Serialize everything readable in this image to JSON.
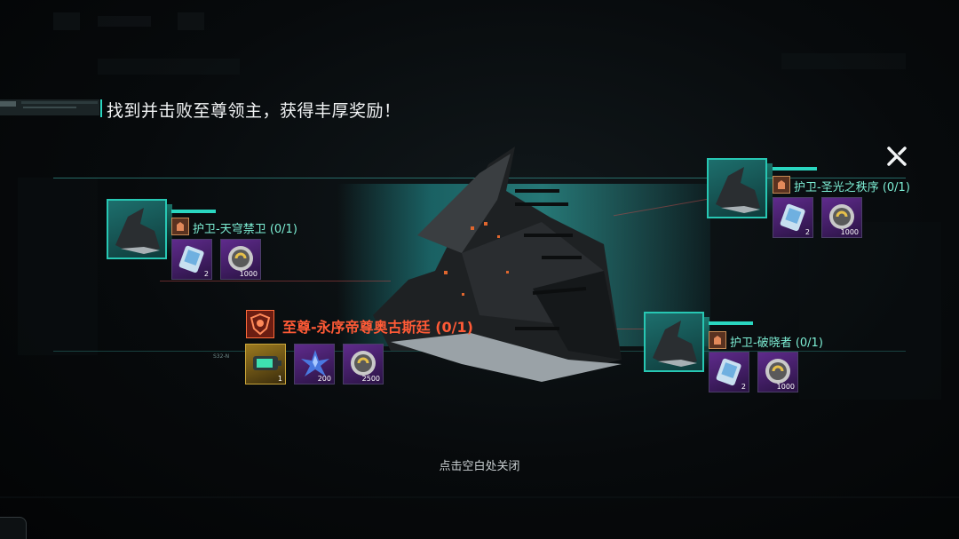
{
  "header": {
    "title": "找到并击败至尊领主，获得丰厚奖励！"
  },
  "close": {
    "icon": "close-icon"
  },
  "boss": {
    "label": "至尊-永序帝尊奥古斯廷 (0/1)",
    "rewards": [
      {
        "icon": "battery-icon",
        "qty": "1",
        "rarity": "gold"
      },
      {
        "icon": "crystal-icon",
        "qty": "200",
        "rarity": "purple"
      },
      {
        "icon": "coin-icon",
        "qty": "2500",
        "rarity": "purple"
      }
    ]
  },
  "guards": [
    {
      "label": "护卫-天穹禁卫 (0/1)",
      "rewards": [
        {
          "icon": "chip-card-icon",
          "qty": "2"
        },
        {
          "icon": "coin-icon",
          "qty": "1000"
        }
      ]
    },
    {
      "label": "护卫-圣光之秩序 (0/1)",
      "rewards": [
        {
          "icon": "chip-card-icon",
          "qty": "2"
        },
        {
          "icon": "coin-icon",
          "qty": "1000"
        }
      ]
    },
    {
      "label": "护卫-破晓者 (0/1)",
      "rewards": [
        {
          "icon": "chip-card-icon",
          "qty": "2"
        },
        {
          "icon": "coin-icon",
          "qty": "1000"
        }
      ]
    }
  ],
  "footer": {
    "hint": "点击空白处关闭"
  },
  "tag": "S32-N",
  "colors": {
    "accent": "#2ad6c0",
    "boss": "#ff5a36",
    "guard_text": "#7ef0d6"
  }
}
